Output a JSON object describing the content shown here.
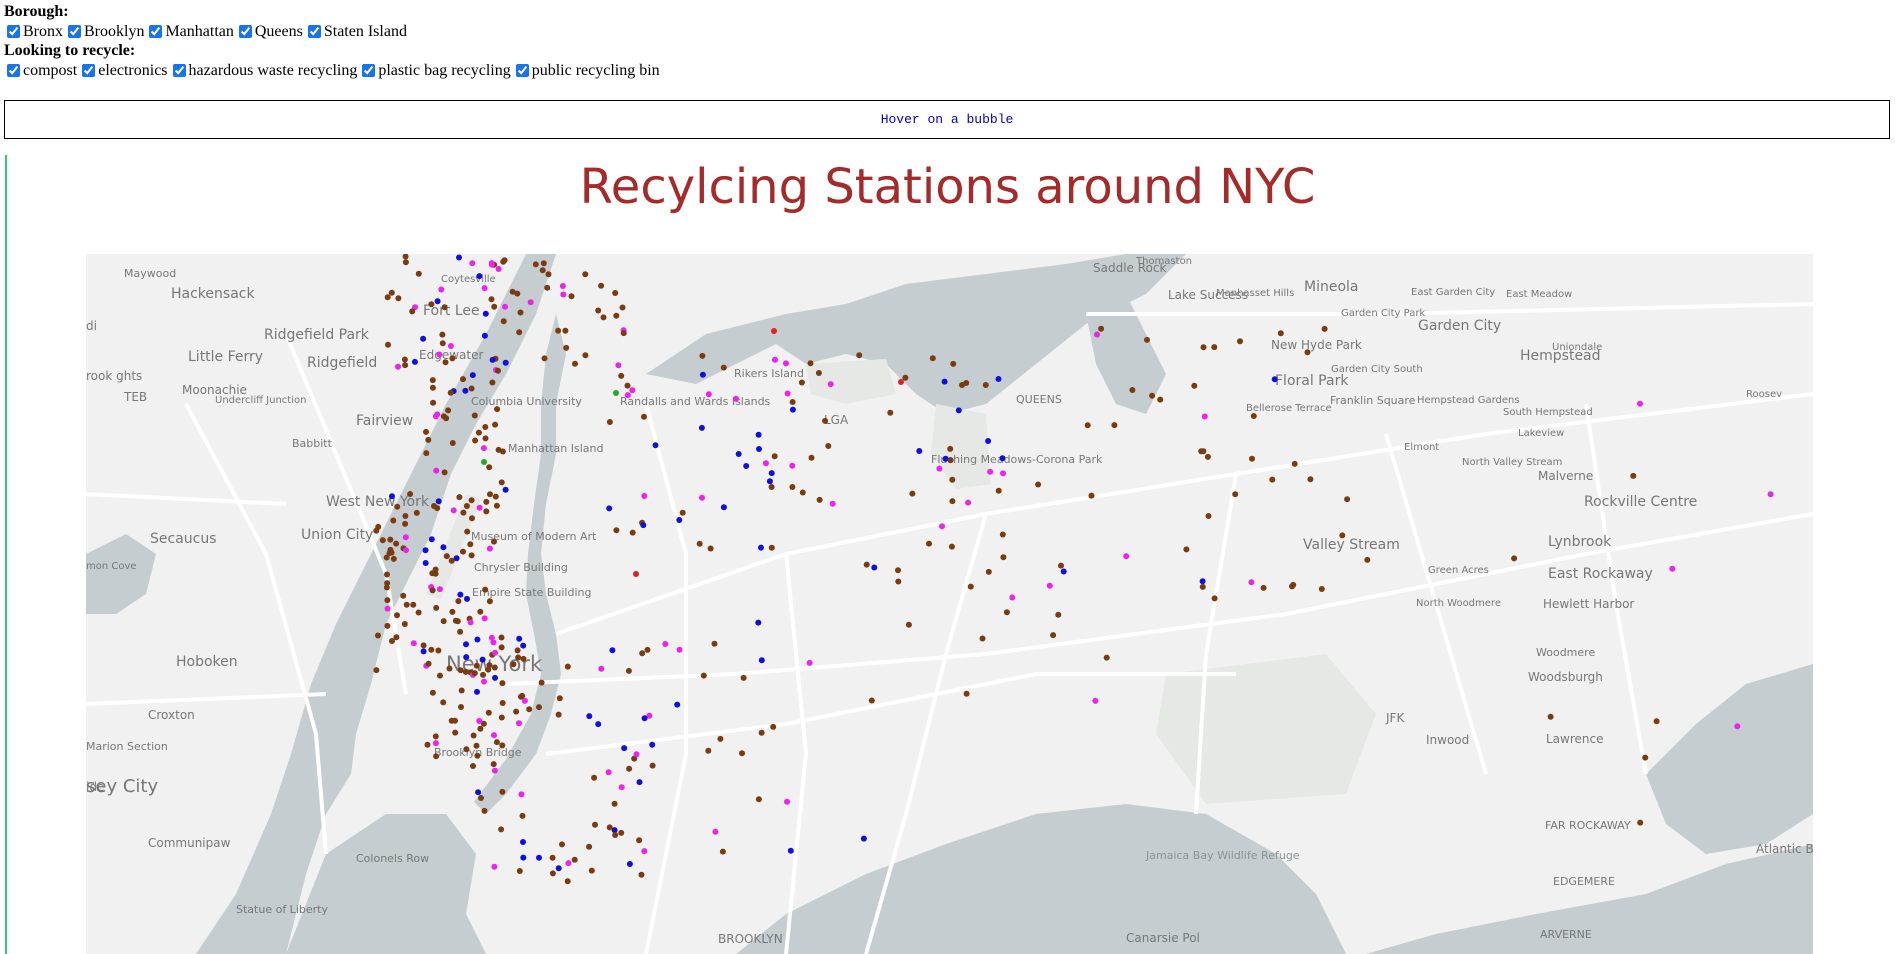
{
  "filters": {
    "borough_heading": "Borough:",
    "boroughs": [
      {
        "label": "Bronx",
        "checked": true
      },
      {
        "label": "Brooklyn",
        "checked": true
      },
      {
        "label": "Manhattan",
        "checked": true
      },
      {
        "label": "Queens",
        "checked": true
      },
      {
        "label": "Staten Island",
        "checked": true
      }
    ],
    "recycle_heading": "Looking to recycle:",
    "recycle_types": [
      {
        "label": "compost",
        "checked": true
      },
      {
        "label": "electronics",
        "checked": true
      },
      {
        "label": "hazardous waste recycling",
        "checked": true
      },
      {
        "label": "plastic bag recycling",
        "checked": true
      },
      {
        "label": "public recycling bin",
        "checked": true
      }
    ]
  },
  "hover_info": "Hover on a bubble",
  "title": "Recylcing Stations around NYC",
  "colors": {
    "title": "#a52a2a",
    "hover_text": "#0000cc",
    "compost": "#7a3b10",
    "electronics": "#1010dd",
    "plastic": "#ee22ee",
    "hazardous": "#dd2222",
    "public": "#22aa22",
    "land": "#f1f1f1",
    "water": "#c5cdd0",
    "park": "#e6e8e6"
  },
  "map": {
    "place_labels": [
      {
        "text": "Maywood",
        "size": 11
      },
      {
        "text": "Hackensack",
        "size": 14
      },
      {
        "text": "Coytesville",
        "size": 10
      },
      {
        "text": "Fort Lee",
        "size": 14
      },
      {
        "text": "Ridgefield Park",
        "size": 14
      },
      {
        "text": "Little Ferry",
        "size": 14
      },
      {
        "text": "Ridgefield",
        "size": 14
      },
      {
        "text": "Edgewater",
        "size": 12
      },
      {
        "text": "Moonachie",
        "size": 12
      },
      {
        "text": "Undercliff Junction",
        "size": 10
      },
      {
        "text": "TEB",
        "size": 12
      },
      {
        "text": "Fairview",
        "size": 14
      },
      {
        "text": "Babbitt",
        "size": 11
      },
      {
        "text": "West New York",
        "size": 14
      },
      {
        "text": "Secaucus",
        "size": 14
      },
      {
        "text": "Union City",
        "size": 14
      },
      {
        "text": "Hoboken",
        "size": 14
      },
      {
        "text": "Croxton",
        "size": 12
      },
      {
        "text": "Marion Section",
        "size": 11
      },
      {
        "text": "sey City",
        "size": 18
      },
      {
        "text": "Communipaw",
        "size": 12
      },
      {
        "text": "Columbia University",
        "size": 11
      },
      {
        "text": "Manhattan Island",
        "size": 11
      },
      {
        "text": "Museum of Modern Art",
        "size": 11
      },
      {
        "text": "Chrysler Building",
        "size": 11
      },
      {
        "text": "Empire State Building",
        "size": 11
      },
      {
        "text": "New York",
        "size": 21
      },
      {
        "text": "Brooklyn Bridge",
        "size": 11
      },
      {
        "text": "Colonels Row",
        "size": 11
      },
      {
        "text": "Statue of Liberty",
        "size": 11
      },
      {
        "text": "Randalls and Wards Islands",
        "size": 11
      },
      {
        "text": "Rikers Island",
        "size": 11
      },
      {
        "text": "LGA",
        "size": 12
      },
      {
        "text": "QUEENS",
        "size": 11
      },
      {
        "text": "Flushing Meadows-Corona Park",
        "size": 11
      },
      {
        "text": "BROOKLYN",
        "size": 12
      },
      {
        "text": "Saddle Rock",
        "size": 12
      },
      {
        "text": "Thomaston",
        "size": 10
      },
      {
        "text": "Lake Success",
        "size": 12
      },
      {
        "text": "Manhasset Hills",
        "size": 10
      },
      {
        "text": "Mineola",
        "size": 14
      },
      {
        "text": "East Garden City",
        "size": 10
      },
      {
        "text": "East Meadow",
        "size": 10
      },
      {
        "text": "Garden City Park",
        "size": 10
      },
      {
        "text": "Garden City",
        "size": 14
      },
      {
        "text": "New Hyde Park",
        "size": 12
      },
      {
        "text": "Hempstead",
        "size": 14
      },
      {
        "text": "Uniondale",
        "size": 10
      },
      {
        "text": "Floral Park",
        "size": 14
      },
      {
        "text": "Garden City South",
        "size": 10
      },
      {
        "text": "Bellerose Terrace",
        "size": 10
      },
      {
        "text": "Franklin Square",
        "size": 11
      },
      {
        "text": "Hempstead Gardens",
        "size": 10
      },
      {
        "text": "Roosev",
        "size": 10
      },
      {
        "text": "South Hempstead",
        "size": 10
      },
      {
        "text": "Lakeview",
        "size": 10
      },
      {
        "text": "Elmont",
        "size": 10
      },
      {
        "text": "North Valley Stream",
        "size": 10
      },
      {
        "text": "Malverne",
        "size": 12
      },
      {
        "text": "Rockville Centre",
        "size": 14
      },
      {
        "text": "Valley Stream",
        "size": 14
      },
      {
        "text": "Lynbrook",
        "size": 14
      },
      {
        "text": "Green Acres",
        "size": 10
      },
      {
        "text": "East Rockaway",
        "size": 14
      },
      {
        "text": "North Woodmere",
        "size": 10
      },
      {
        "text": "Hewlett Harbor",
        "size": 12
      },
      {
        "text": "Woodmere",
        "size": 11
      },
      {
        "text": "Woodsburgh",
        "size": 12
      },
      {
        "text": "JFK",
        "size": 12
      },
      {
        "text": "Inwood",
        "size": 12
      },
      {
        "text": "Lawrence",
        "size": 12
      },
      {
        "text": "FAR ROCKAWAY",
        "size": 11
      },
      {
        "text": "Atlantic B",
        "size": 12
      },
      {
        "text": "EDGEMERE",
        "size": 11
      },
      {
        "text": "ARVERNE",
        "size": 11
      },
      {
        "text": "Jamaica Bay Wildlife Refuge",
        "size": 11
      },
      {
        "text": "Canarsie Pol",
        "size": 12
      },
      {
        "text": "mon Cove",
        "size": 10
      },
      {
        "text": "di",
        "size": 12
      },
      {
        "text": "rook ghts",
        "size": 12
      },
      {
        "text": "ide",
        "size": 12
      }
    ]
  }
}
